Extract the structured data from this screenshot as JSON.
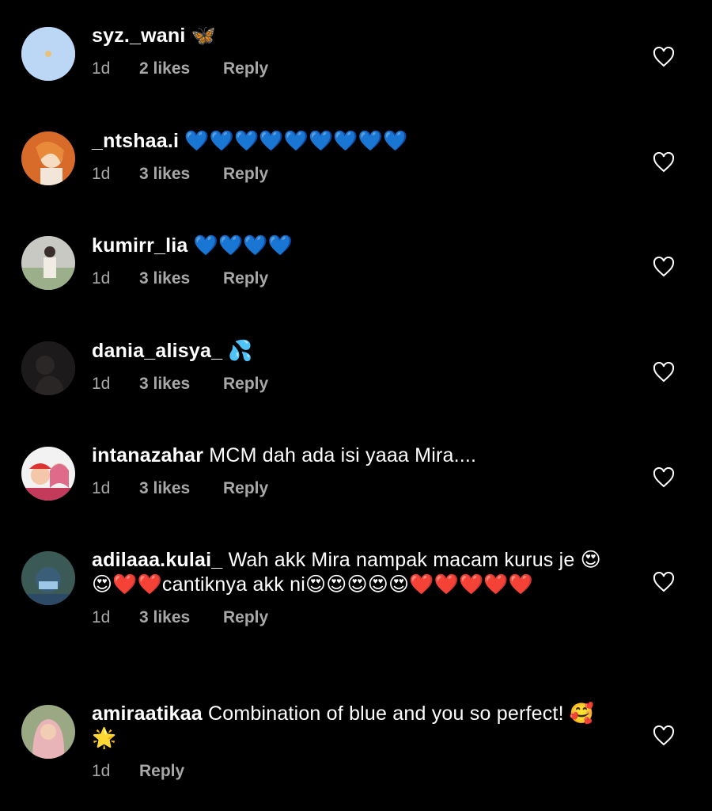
{
  "comments": [
    {
      "username": "syz._wani",
      "text": "",
      "emoji": "🦋",
      "time": "1d",
      "likes": "2 likes",
      "reply": "Reply"
    },
    {
      "username": "_ntshaa.i",
      "text": "",
      "emoji": "💙💙💙💙💙💙💙💙💙",
      "time": "1d",
      "likes": "3 likes",
      "reply": "Reply"
    },
    {
      "username": "kumirr_lia",
      "text": "",
      "emoji": "💙💙💙💙",
      "time": "1d",
      "likes": "3 likes",
      "reply": "Reply"
    },
    {
      "username": "dania_alisya_",
      "text": "",
      "emoji": "💦",
      "time": "1d",
      "likes": "3 likes",
      "reply": "Reply"
    },
    {
      "username": "intanazahar",
      "text": "MCM dah ada isi yaaa Mira....",
      "emoji": "",
      "time": "1d",
      "likes": "3 likes",
      "reply": "Reply"
    },
    {
      "username": "adilaaa.kulai_",
      "text": "Wah akk Mira nampak macam kurus je 😍😍❤️❤️cantiknya akk ni😍😍😍😍😍❤️❤️❤️❤️❤️",
      "emoji": "",
      "time": "1d",
      "likes": "3 likes",
      "reply": "Reply"
    },
    {
      "username": "amiraatikaa",
      "text": "Combination of blue and you so perfect! 🥰🌟",
      "emoji": "",
      "time": "1d",
      "likes": "",
      "reply": "Reply"
    }
  ],
  "icons": {
    "like": "heart-outline-icon"
  },
  "colors": {
    "background": "#000000",
    "text": "#ffffff",
    "meta": "#a8a8a8"
  }
}
